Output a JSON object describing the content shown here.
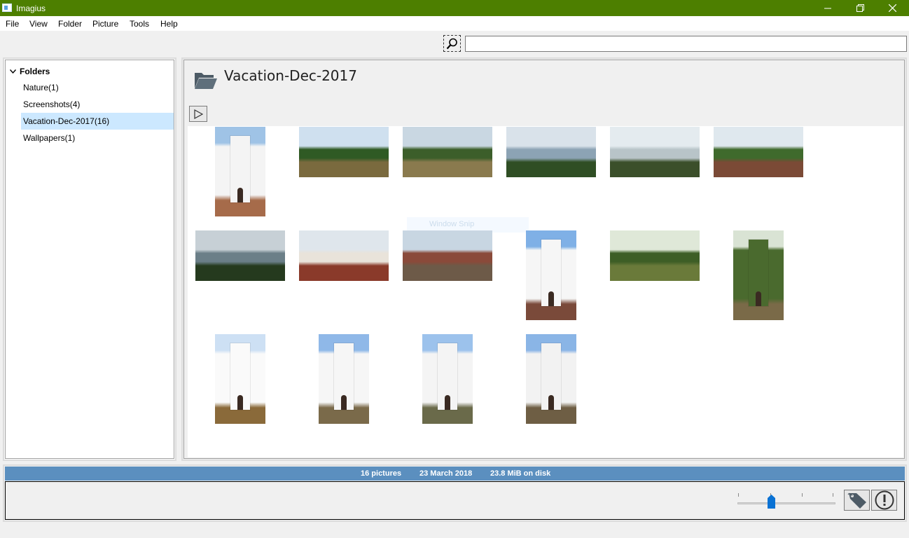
{
  "window": {
    "title": "Imagius",
    "colors": {
      "titlebar": "#4d7f00",
      "selection": "#cce8ff",
      "status_strip": "#5b8fbf"
    }
  },
  "menu": [
    "File",
    "View",
    "Folder",
    "Picture",
    "Tools",
    "Help"
  ],
  "search": {
    "value": "",
    "icon": "search-icon"
  },
  "sidebar": {
    "root_label": "Folders",
    "items": [
      {
        "label": "Nature(1)",
        "selected": false
      },
      {
        "label": "Screenshots(4)",
        "selected": false
      },
      {
        "label": "Vacation-Dec-2017(16)",
        "selected": true
      },
      {
        "label": "Wallpapers(1)",
        "selected": false
      }
    ]
  },
  "main": {
    "folder_title": "Vacation-Dec-2017",
    "folder_icon": "folder-open-icon",
    "play_icon": "play-icon",
    "ghost_label": "Window Snip",
    "thumbnails": [
      {
        "subject": "church arch",
        "orientation": "portrait",
        "palette": [
          "#9fc3e6",
          "#f4f4f4",
          "#a66b4a"
        ]
      },
      {
        "subject": "palms and sea",
        "orientation": "landscape",
        "palette": [
          "#cfe0ef",
          "#2f5a24",
          "#7a6a3e"
        ]
      },
      {
        "subject": "palm coast",
        "orientation": "landscape",
        "palette": [
          "#c9d7e2",
          "#3c5e2a",
          "#8a7a4e"
        ]
      },
      {
        "subject": "bay view",
        "orientation": "landscape",
        "palette": [
          "#d9e2ea",
          "#8ca3b4",
          "#2f4e24"
        ]
      },
      {
        "subject": "hazy coast",
        "orientation": "landscape",
        "palette": [
          "#e4ebef",
          "#b8c4c8",
          "#3b4f2a"
        ]
      },
      {
        "subject": "fort wall",
        "orientation": "landscape",
        "palette": [
          "#dfe8ee",
          "#3f6a2c",
          "#7b4a36"
        ]
      },
      {
        "subject": "sea horizon",
        "orientation": "landscape",
        "palette": [
          "#c7d0d6",
          "#6b7f88",
          "#253a1e"
        ]
      },
      {
        "subject": "old house",
        "orientation": "landscape",
        "palette": [
          "#dfe6ec",
          "#e9e3da",
          "#8a3a2a"
        ]
      },
      {
        "subject": "fort ruins",
        "orientation": "landscape",
        "palette": [
          "#c8d6e2",
          "#8a4a3a",
          "#6d5a48"
        ]
      },
      {
        "subject": "white church",
        "orientation": "portrait",
        "palette": [
          "#7fb0e6",
          "#f6f6f6",
          "#7a4a3a"
        ]
      },
      {
        "subject": "forest",
        "orientation": "landscape",
        "palette": [
          "#dfe8d8",
          "#3d5e26",
          "#6a7a3a"
        ]
      },
      {
        "subject": "forest path",
        "orientation": "portrait",
        "palette": [
          "#d9e3d4",
          "#4a6a2e",
          "#7a6a48"
        ]
      },
      {
        "subject": "church tower",
        "orientation": "portrait",
        "palette": [
          "#cde0f4",
          "#fafafa",
          "#8a6a3a"
        ]
      },
      {
        "subject": "church tower",
        "orientation": "portrait",
        "palette": [
          "#8fb8e8",
          "#f6f6f6",
          "#7a6a4a"
        ]
      },
      {
        "subject": "church tower",
        "orientation": "portrait",
        "palette": [
          "#9cc2ec",
          "#f4f4f4",
          "#6a6a4a"
        ]
      },
      {
        "subject": "church tower",
        "orientation": "portrait",
        "palette": [
          "#8ab5e6",
          "#f2f2f2",
          "#6e5e44"
        ]
      }
    ]
  },
  "status": {
    "pictures": "16 pictures",
    "date": "23 March 2018",
    "disk": "23.8 MiB on disk"
  },
  "bottom": {
    "zoom_slider_value": 0.33,
    "tag_icon": "tag-icon",
    "warning_icon": "warning-icon"
  }
}
